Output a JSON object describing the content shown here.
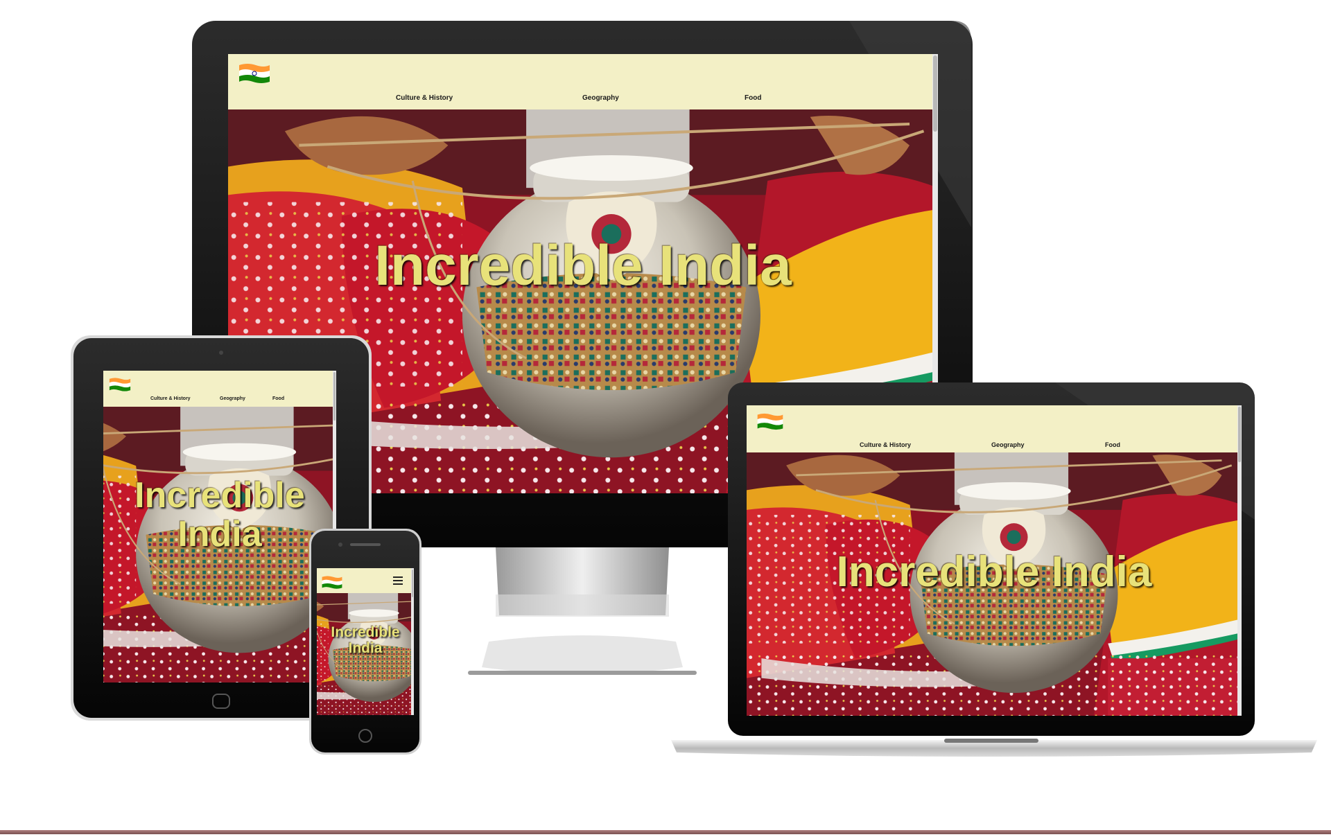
{
  "site": {
    "nav": [
      "Culture & History",
      "Geography",
      "Food"
    ],
    "hero_title": "Incredible India",
    "hero_title_lines": [
      "Incredible",
      "India"
    ]
  },
  "colors": {
    "header_bg": "#f3f0c6",
    "hero_title": "#e8e27a",
    "flag_saffron": "#ff9933",
    "flag_green": "#138808"
  },
  "icons": {
    "flag": "india-flag-icon",
    "menu": "hamburger-menu-icon"
  }
}
